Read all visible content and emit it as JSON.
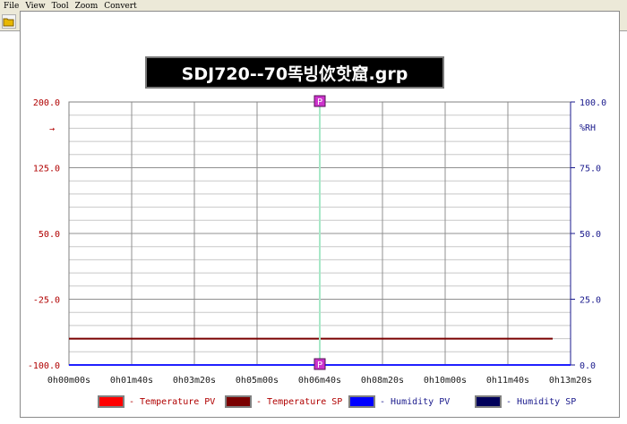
{
  "menu": [
    "File",
    "View",
    "Tool",
    "Zoom",
    "Convert"
  ],
  "toolbar": {
    "buttons": [
      {
        "name": "open-icon",
        "color": "#d9a400"
      },
      {
        "name": "people-icon",
        "color": "#2f7a2f"
      },
      {
        "name": "zoom-page-icon",
        "color": "#204080"
      },
      {
        "name": "zoom-page2-icon",
        "color": "#204080"
      },
      {
        "name": "zoom-in-icon",
        "color": "#808080"
      },
      {
        "name": "zoom-out-icon",
        "color": "#808080"
      },
      {
        "name": "excel-icon",
        "color": "#1a8a1a"
      },
      {
        "name": "print-icon",
        "color": "#505050"
      }
    ]
  },
  "title": "SDJ720--70똑빙佽핫窟.grp",
  "chart_data": {
    "type": "line",
    "x_ticks": [
      "0h00m00s",
      "0h01m40s",
      "0h03m20s",
      "0h05m00s",
      "0h06m40s",
      "0h08m20s",
      "0h10m00s",
      "0h11m40s",
      "0h13m20s"
    ],
    "left_axis": {
      "ticks": [
        "200.0",
        "125.0",
        "50.0",
        "-25.0",
        "-100.0"
      ],
      "range": [
        -100,
        200
      ],
      "color": "#b00000",
      "arrow": "→"
    },
    "right_axis": {
      "ticks": [
        "100.0",
        "75.0",
        "50.0",
        "25.0",
        "0.0"
      ],
      "range": [
        0,
        100
      ],
      "unit": "%RH",
      "color": "#1a1a8c"
    },
    "cursor_marker": "P",
    "series": [
      {
        "name": "Temperature PV",
        "axis": "left",
        "color": "#ff0000",
        "value": null
      },
      {
        "name": "Temperature SP",
        "axis": "left",
        "color": "#7a0000",
        "value": -70
      },
      {
        "name": "Humidity PV",
        "axis": "right",
        "color": "#0000ff",
        "value": null
      },
      {
        "name": "Humidity SP",
        "axis": "right",
        "color": "#00005a",
        "value": 0
      }
    ]
  }
}
